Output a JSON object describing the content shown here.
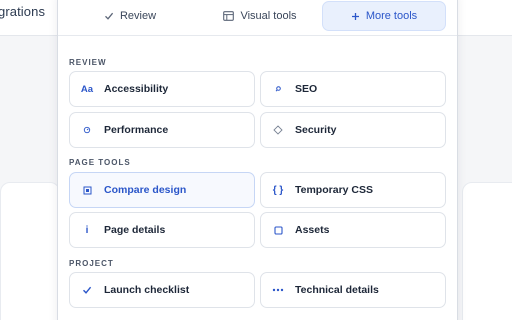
{
  "background": {
    "title": "grations"
  },
  "tabs": [
    {
      "label": "Review",
      "icon": "check-icon"
    },
    {
      "label": "Visual tools",
      "icon": "table-icon"
    },
    {
      "label": "More tools",
      "icon": "plus-icon",
      "active": true
    }
  ],
  "sections": {
    "review": {
      "label": "REVIEW",
      "items": [
        {
          "label": "Accessibility",
          "icon": "text-size-icon"
        },
        {
          "label": "SEO",
          "icon": "search-icon"
        },
        {
          "label": "Performance",
          "icon": "gauge-icon"
        },
        {
          "label": "Security",
          "icon": "shield-icon"
        }
      ]
    },
    "page_tools": {
      "label": "PAGE TOOLS",
      "items": [
        {
          "label": "Compare design",
          "icon": "compare-icon",
          "active": true
        },
        {
          "label": "Temporary CSS",
          "icon": "code-braces-icon"
        },
        {
          "label": "Page details",
          "icon": "info-icon"
        },
        {
          "label": "Assets",
          "icon": "square-icon"
        }
      ]
    },
    "project": {
      "label": "PROJECT",
      "items": [
        {
          "label": "Launch checklist",
          "icon": "check-icon"
        },
        {
          "label": "Technical details",
          "icon": "more-dots-icon"
        }
      ]
    }
  },
  "colors": {
    "accent": "#2b56c9",
    "accent_bg": "#e9f0fd",
    "border": "#dfe3e9"
  }
}
